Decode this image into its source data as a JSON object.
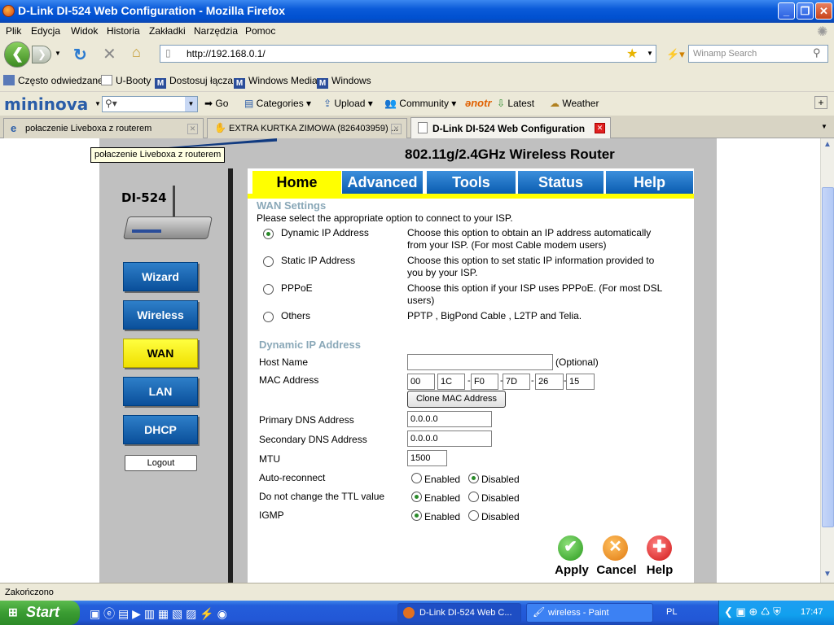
{
  "window": {
    "title": "D-Link DI-524 Web Configuration - Mozilla Firefox"
  },
  "menu": [
    "Plik",
    "Edycja",
    "Widok",
    "Historia",
    "Zakładki",
    "Narzędzia",
    "Pomoc"
  ],
  "nav": {
    "url": "http://192.168.0.1/",
    "search_placeholder": "Winamp Search"
  },
  "bookmarks": [
    "Często odwiedzane",
    "U-Booty",
    "Dostosuj łącza",
    "Windows Media",
    "Windows"
  ],
  "mininova": {
    "logo": "mininova",
    "go": "Go",
    "items": [
      "Categories",
      "Upload",
      "Community",
      "Latest",
      "Weather"
    ],
    "notr": "notr"
  },
  "tabs": [
    {
      "label": "połaczenie Liveboxa z routerem"
    },
    {
      "label": "EXTRA KURTKA ZIMOWA (826403959) ..."
    },
    {
      "label": "D-Link DI-524 Web Configuration"
    }
  ],
  "tooltip": "połaczenie Liveboxa z routerem",
  "router": {
    "header": "802.11g/2.4GHz Wireless Router",
    "model": "DI-524",
    "top_tabs": [
      "Home",
      "Advanced",
      "Tools",
      "Status",
      "Help"
    ],
    "side_buttons": [
      "Wizard",
      "Wireless",
      "WAN",
      "LAN",
      "DHCP"
    ],
    "logout": "Logout",
    "wan_title": "WAN Settings",
    "wan_intro": "Please select the appropriate option to connect to your ISP.",
    "options": [
      {
        "label": "Dynamic IP Address",
        "desc1": "Choose this option to obtain an IP address automatically",
        "desc2": "from your ISP. (For most Cable modem users)",
        "selected": true
      },
      {
        "label": "Static IP Address",
        "desc1": "Choose this option to set static IP information provided to",
        "desc2": "you by your ISP.",
        "selected": false
      },
      {
        "label": "PPPoE",
        "desc1": "Choose this option if your ISP uses PPPoE. (For most DSL",
        "desc2": "users)",
        "selected": false
      },
      {
        "label": "Others",
        "desc1": "PPTP , BigPond Cable , L2TP and Telia.",
        "desc2": "",
        "selected": false
      }
    ],
    "dyn_title": "Dynamic IP Address",
    "host_name_label": "Host Name",
    "host_name_value": "",
    "optional": "(Optional)",
    "mac_label": "MAC Address",
    "mac": [
      "00",
      "1C",
      "F0",
      "7D",
      "26",
      "15"
    ],
    "mac_sep": "-",
    "clone_mac": "Clone MAC Address",
    "primary_dns_label": "Primary DNS Address",
    "primary_dns": "0.0.0.0",
    "secondary_dns_label": "Secondary DNS Address",
    "secondary_dns": "0.0.0.0",
    "mtu_label": "MTU",
    "mtu": "1500",
    "auto_reconnect_label": "Auto-reconnect",
    "ttl_label": "Do not change the TTL value",
    "igmp_label": "IGMP",
    "enabled": "Enabled",
    "disabled": "Disabled",
    "apply": "Apply",
    "cancel": "Cancel",
    "help": "Help"
  },
  "status": "Zakończono",
  "taskbar": {
    "start": "Start",
    "tasks": [
      "D-Link DI-524 Web C...",
      "wireless - Paint"
    ],
    "lang": "PL",
    "clock": "17:47"
  },
  "colors": {
    "dlink_blue": "#0a5cb0",
    "dlink_yellow": "#ffff00",
    "xp_blue": "#245edb"
  }
}
